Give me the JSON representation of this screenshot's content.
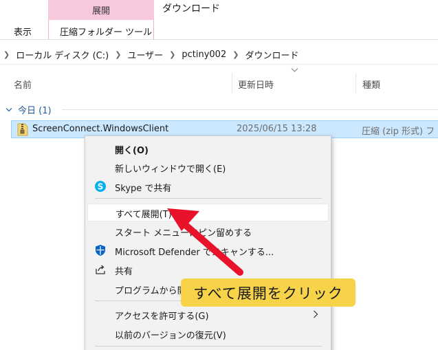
{
  "ribbon": {
    "context_tab_header": "展開",
    "window_title": "ダウンロード",
    "tab_view": "表示",
    "tab_compressed_tools": "圧縮フォルダー ツール"
  },
  "address_bar": {
    "crumbs": [
      "ローカル ディスク (C:)",
      "ユーザー",
      "pctiny002",
      "ダウンロード"
    ]
  },
  "columns": {
    "name": "名前",
    "date_modified": "更新日時",
    "type": "種類"
  },
  "group": {
    "label": "今日 (1)"
  },
  "file": {
    "name": "ScreenConnect.WindowsClient",
    "date": "2025/06/15 13:28",
    "type": "圧縮 (zip 形式) フ"
  },
  "context_menu": {
    "open": "開く(O)",
    "open_new_window": "新しいウィンドウで開く(E)",
    "skype_share": "Skype で共有",
    "extract_all": "すべて展開(T)...",
    "pin_start": "スタート メニューにピン留めする",
    "defender_scan": "Microsoft Defender でスキャンする...",
    "share": "共有",
    "open_with": "プログラムから開く",
    "give_access": "アクセスを許可する(G)",
    "restore_versions": "以前のバージョンの復元(V)"
  },
  "annotation": {
    "callout_text": "すべて展開をクリック"
  },
  "colors": {
    "selection_bg": "#cce8ff",
    "selection_border": "#99d1ff",
    "context_tab_pink": "#f8c8dc",
    "arrow_red": "#e8132b",
    "callout_yellow": "#f7d34a",
    "group_blue": "#1e5a96",
    "skype_blue": "#00aff0",
    "defender_blue": "#0a64c8"
  },
  "icons": {
    "file": "zip-folder-icon",
    "skype": "skype-icon",
    "defender": "defender-shield-icon",
    "share": "share-icon"
  }
}
